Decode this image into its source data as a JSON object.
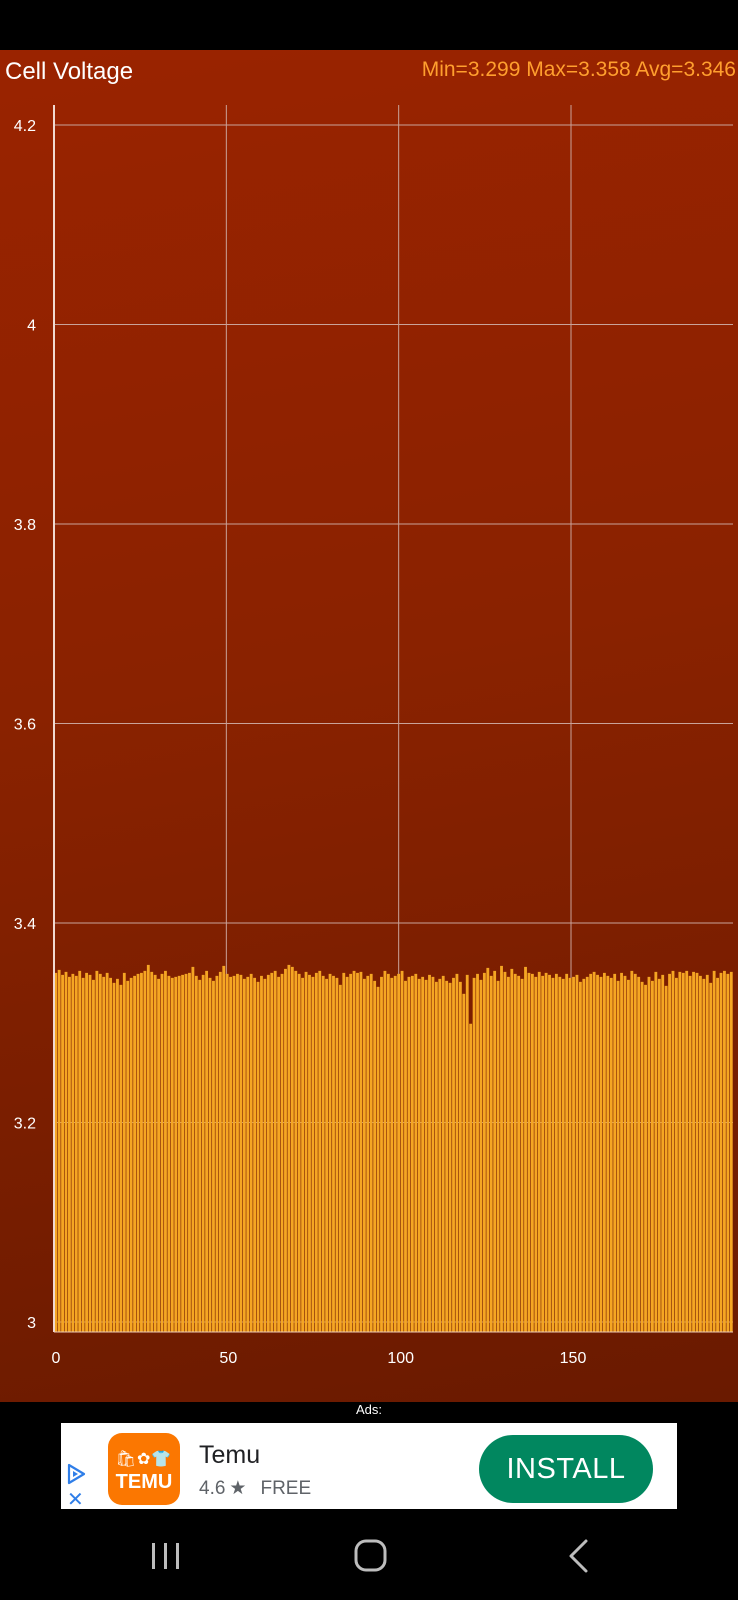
{
  "chart_title": "Cell Voltage",
  "stats_text": "Min=3.299 Max=3.358 Avg=3.346",
  "ads_label": "Ads:",
  "ad": {
    "logo_text": "TEMU",
    "app_name": "Temu",
    "rating": "4.6",
    "price": "FREE",
    "install_label": "INSTALL",
    "icons": [
      "ad-choices-icon",
      "close-icon",
      "star-icon"
    ]
  },
  "nav": {
    "icons": [
      "recent-apps-icon",
      "home-icon",
      "back-icon"
    ]
  },
  "colors": {
    "background_top": "#9a2300",
    "background_bottom": "#6a1a00",
    "bar": "#f5a623",
    "title": "#ffffff",
    "stats": "#ff9f2e",
    "grid": "#c9a39a",
    "install_button": "#01875f",
    "temu_orange": "#fb7701"
  },
  "chart_data": {
    "type": "bar",
    "title": "Cell Voltage",
    "xlabel": "",
    "ylabel": "",
    "xlim": [
      0,
      197
    ],
    "ylim": [
      2.99,
      4.22
    ],
    "x_ticks": [
      "0",
      "50",
      "100",
      "150"
    ],
    "y_ticks": [
      "3",
      "3.2",
      "3.4",
      "3.6",
      "3.8",
      "4",
      "4.2"
    ],
    "grid": true,
    "legend": "none",
    "series": [
      {
        "values": [
          3.35,
          3.353,
          3.348,
          3.351,
          3.346,
          3.349,
          3.347,
          3.352,
          3.345,
          3.35,
          3.348,
          3.343,
          3.352,
          3.349,
          3.346,
          3.35,
          3.345,
          3.34,
          3.344,
          3.338,
          3.35,
          3.342,
          3.345,
          3.347,
          3.349,
          3.35,
          3.352,
          3.358,
          3.351,
          3.348,
          3.344,
          3.349,
          3.352,
          3.347,
          3.345,
          3.346,
          3.347,
          3.348,
          3.349,
          3.35,
          3.356,
          3.347,
          3.343,
          3.348,
          3.352,
          3.345,
          3.342,
          3.347,
          3.351,
          3.357,
          3.349,
          3.346,
          3.347,
          3.349,
          3.348,
          3.344,
          3.346,
          3.349,
          3.345,
          3.341,
          3.347,
          3.344,
          3.348,
          3.35,
          3.352,
          3.346,
          3.349,
          3.354,
          3.358,
          3.356,
          3.352,
          3.349,
          3.345,
          3.351,
          3.348,
          3.346,
          3.35,
          3.352,
          3.347,
          3.344,
          3.349,
          3.347,
          3.345,
          3.338,
          3.35,
          3.346,
          3.349,
          3.352,
          3.35,
          3.351,
          3.344,
          3.347,
          3.349,
          3.342,
          3.336,
          3.346,
          3.352,
          3.349,
          3.345,
          3.347,
          3.349,
          3.352,
          3.342,
          3.346,
          3.347,
          3.349,
          3.344,
          3.346,
          3.343,
          3.348,
          3.346,
          3.341,
          3.344,
          3.347,
          3.342,
          3.34,
          3.345,
          3.349,
          3.341,
          3.329,
          3.348,
          3.299,
          3.345,
          3.349,
          3.343,
          3.35,
          3.355,
          3.347,
          3.352,
          3.342,
          3.357,
          3.351,
          3.346,
          3.354,
          3.349,
          3.347,
          3.344,
          3.356,
          3.35,
          3.349,
          3.346,
          3.351,
          3.347,
          3.35,
          3.348,
          3.345,
          3.349,
          3.346,
          3.344,
          3.349,
          3.345,
          3.346,
          3.348,
          3.341,
          3.344,
          3.346,
          3.349,
          3.351,
          3.348,
          3.346,
          3.35,
          3.347,
          3.345,
          3.349,
          3.342,
          3.35,
          3.347,
          3.343,
          3.352,
          3.349,
          3.346,
          3.341,
          3.338,
          3.346,
          3.342,
          3.351,
          3.344,
          3.348,
          3.337,
          3.349,
          3.352,
          3.345,
          3.351,
          3.35,
          3.352,
          3.347,
          3.351,
          3.35,
          3.347,
          3.344,
          3.348,
          3.34,
          3.352,
          3.345,
          3.35,
          3.352,
          3.349,
          3.351
        ]
      }
    ]
  }
}
